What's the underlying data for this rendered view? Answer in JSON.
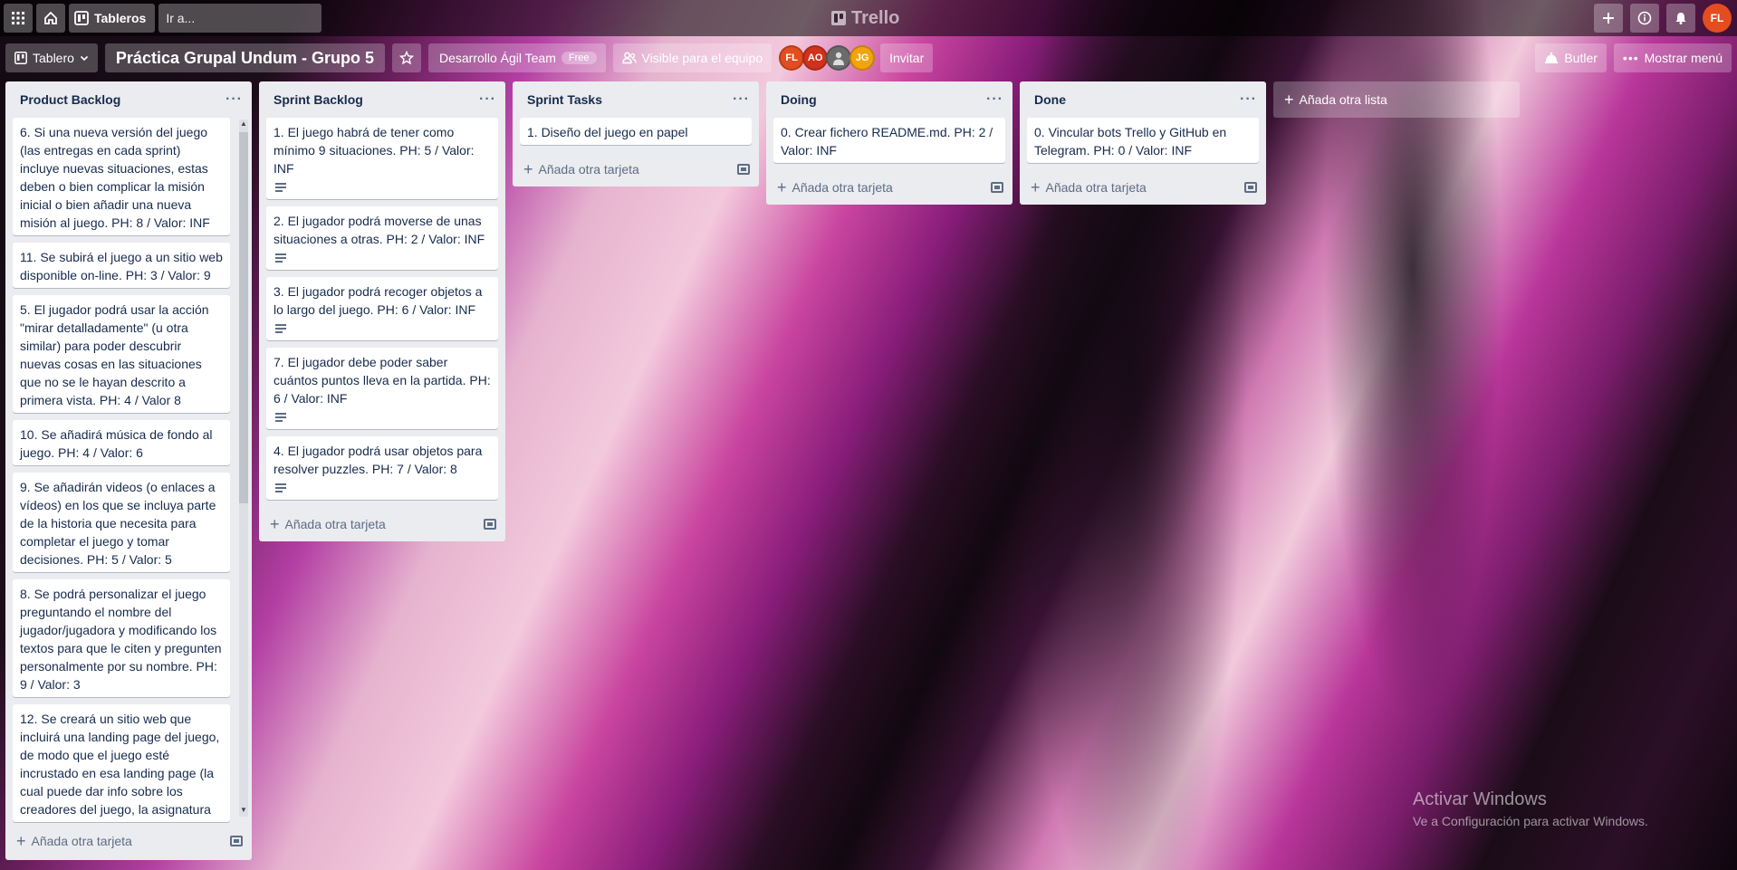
{
  "header": {
    "boards_label": "Tableros",
    "search_placeholder": "Ir a...",
    "logo_text": "Trello",
    "user_initials": "FL"
  },
  "board": {
    "view_label": "Tablero",
    "title": "Práctica Grupal Undum - Grupo 5",
    "team_name": "Desarrollo Ágil Team",
    "plan_badge": "Free",
    "visibility": "Visible para el equipo",
    "members": [
      {
        "initials": "FL",
        "color": "#e34d1f"
      },
      {
        "initials": "AO",
        "color": "#d0321c"
      },
      {
        "initials": "",
        "color": "#6b6b6b"
      },
      {
        "initials": "JG",
        "color": "#f2a40f"
      }
    ],
    "invite_label": "Invitar",
    "butler_label": "Butler",
    "menu_label": "Mostrar menú"
  },
  "lists": [
    {
      "title": "Product Backlog",
      "cards": [
        {
          "text": "6. Si una nueva versión del juego (las entregas en cada sprint) incluye nuevas situaciones, estas deben o bien complicar la misión inicial o bien añadir una nueva misión al juego. PH: 8 / Valor: INF"
        },
        {
          "text": "11. Se subirá el juego a un sitio web disponible on-line. PH: 3 / Valor: 9"
        },
        {
          "text": "5. El jugador podrá usar la acción \"mirar detalladamente\" (u otra similar) para poder descubrir nuevas cosas en las situaciones que no se le hayan descrito a primera vista. PH: 4 / Valor 8"
        },
        {
          "text": "10. Se añadirá música de fondo al juego. PH: 4 / Valor: 6"
        },
        {
          "text": "9. Se añadirán videos (o enlaces a vídeos) en los que se incluya parte de la historia que necesita para completar el juego y tomar decisiones. PH: 5 / Valor: 5"
        },
        {
          "text": "8. Se podrá personalizar el juego preguntando el nombre del jugador/jugadora y modificando los textos para que le citen y pregunten personalmente por su nombre. PH: 9 / Valor: 3"
        },
        {
          "text": "12. Se creará un sitio web que incluirá una landing page del juego, de modo que el juego esté incrustado en esa landing page (la cual puede dar info sobre los creadores del juego, la asignatura"
        }
      ],
      "add_card": "Añada otra tarjeta"
    },
    {
      "title": "Sprint Backlog",
      "cards": [
        {
          "text": "1. El juego habrá de tener como mínimo 9 situaciones. PH: 5 / Valor: INF",
          "has_desc": true
        },
        {
          "text": "2. El jugador podrá moverse de unas situaciones a otras. PH: 2 / Valor: INF",
          "has_desc": true
        },
        {
          "text": "3. El jugador podrá recoger objetos a lo largo del juego. PH: 6 / Valor: INF",
          "has_desc": true
        },
        {
          "text": "7. El jugador debe poder saber cuántos puntos lleva en la partida. PH: 6 / Valor: INF",
          "has_desc": true
        },
        {
          "text": "4. El jugador podrá usar objetos para resolver puzzles. PH: 7 / Valor: 8",
          "has_desc": true
        }
      ],
      "add_card": "Añada otra tarjeta"
    },
    {
      "title": "Sprint Tasks",
      "cards": [
        {
          "text": "1. Diseño del juego en papel"
        }
      ],
      "add_card": "Añada otra tarjeta"
    },
    {
      "title": "Doing",
      "cards": [
        {
          "text": "0. Crear fichero README.md. PH: 2 / Valor: INF"
        }
      ],
      "add_card": "Añada otra tarjeta"
    },
    {
      "title": "Done",
      "cards": [
        {
          "text": "0. Vincular bots Trello y GitHub en Telegram. PH: 0 / Valor: INF"
        }
      ],
      "add_card": "Añada otra tarjeta"
    }
  ],
  "add_list_label": "Añada otra lista",
  "watermark": {
    "line1": "Activar Windows",
    "line2": "Ve a Configuración para activar Windows."
  }
}
